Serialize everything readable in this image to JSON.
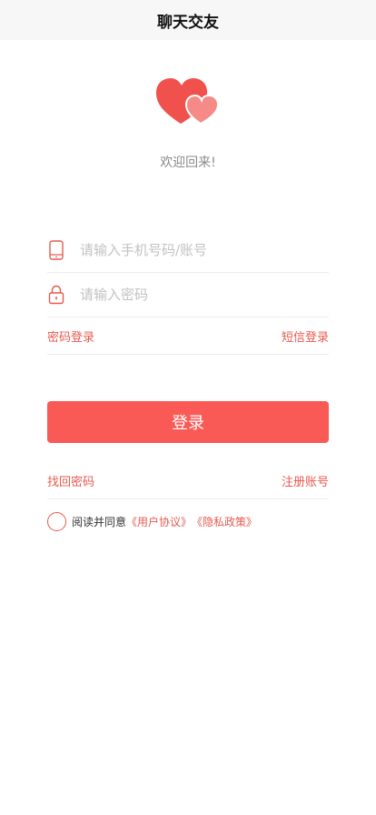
{
  "nav": {
    "title": "聊天交友"
  },
  "welcome": "欢迎回来!",
  "form": {
    "phone_placeholder": "请输入手机号码/账号",
    "password_placeholder": "请输入密码",
    "phone_icon": "phone-icon",
    "lock_icon": "lock-icon"
  },
  "login_mode": {
    "password_login": "密码登录",
    "sms_login": "短信登录"
  },
  "login_button": "登录",
  "links": {
    "forgot_password": "找回密码",
    "register": "注册账号"
  },
  "agreement": {
    "prefix": "阅读并同意",
    "user_agreement": "《用户协议》",
    "privacy_policy": "《隐私政策》"
  },
  "colors": {
    "accent": "#fa5a56",
    "link": "#e65a50",
    "logo_light": "#f58a86"
  }
}
